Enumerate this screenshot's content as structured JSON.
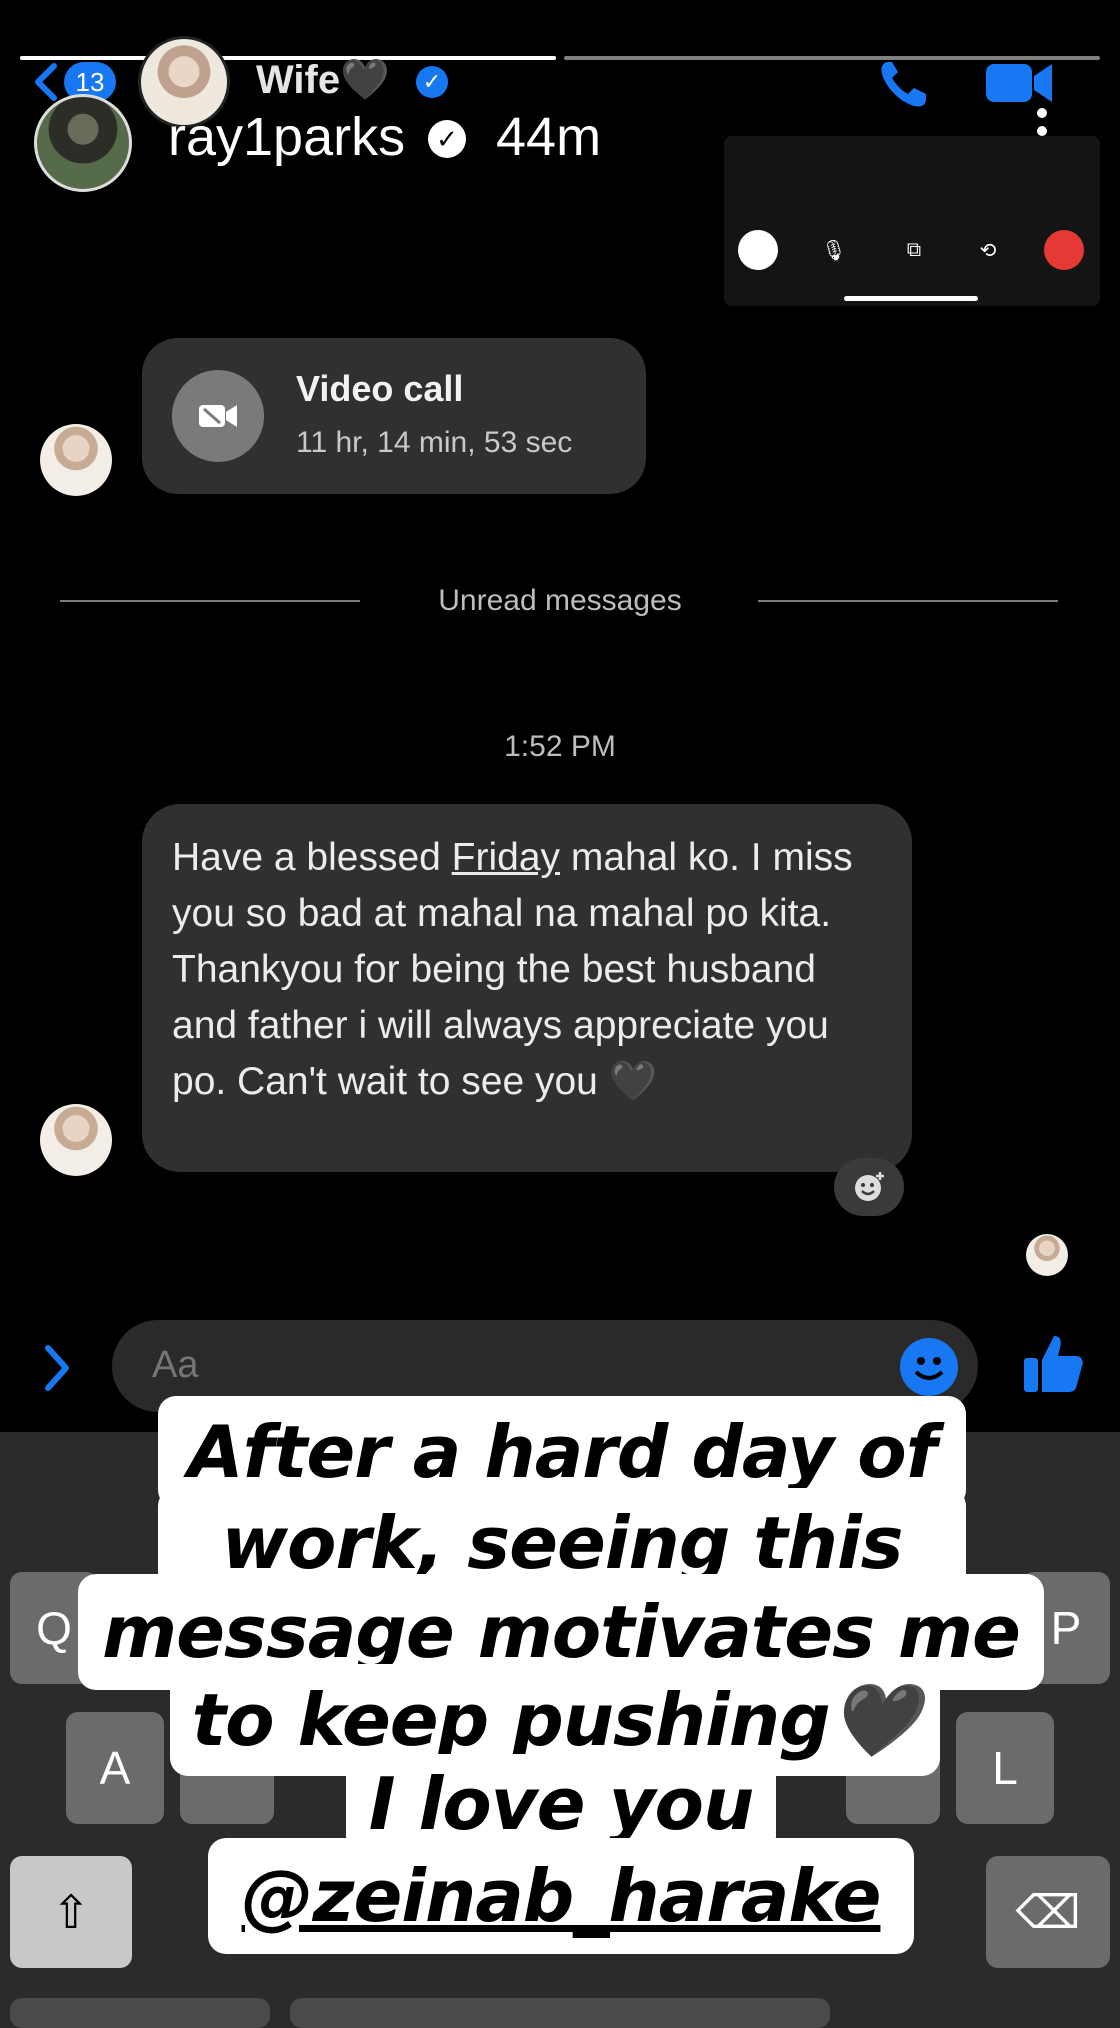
{
  "story": {
    "progress": [
      1.0,
      0.0
    ],
    "username": "ray1parks",
    "time_ago": "44m",
    "verified_icon": "verified-check-icon",
    "more_icon": "more-vertical-icon"
  },
  "messenger": {
    "header": {
      "unread_count": "13",
      "contact_name": "Wife",
      "contact_emoji": "🖤",
      "verified_icon": "verified-badge-icon",
      "call_icon": "phone-icon",
      "video_icon": "video-camera-icon"
    },
    "call_bubble": {
      "title": "Video call",
      "duration": "11 hr, 14 min, 53 sec",
      "icon": "video-call-icon"
    },
    "unread_divider": "Unread messages",
    "timestamp": "1:52 PM",
    "message": {
      "part1": "Have a blessed ",
      "underlined": "Friday",
      "part2": " mahal ko. I miss you so bad at mahal na mahal po kita. Thankyou for being the best husband and father i will always appreciate you po. Can't wait to see you ",
      "emoji": "🖤"
    },
    "composer": {
      "placeholder": "Aa"
    },
    "colors": {
      "accent": "#1877f2",
      "bubble": "#303030",
      "end_call": "#e53935"
    }
  },
  "keyboard": {
    "keys": {
      "q": "Q",
      "p": "P",
      "a": "A",
      "l": "L",
      "shift": "⇧",
      "backspace": "⌫"
    }
  },
  "caption": {
    "line1": "After a hard day of",
    "line2": "work, seeing this",
    "line3": "message motivates me",
    "line4": "to keep pushing🖤",
    "line5": "I love you",
    "mention": "@zeinab_harake"
  }
}
